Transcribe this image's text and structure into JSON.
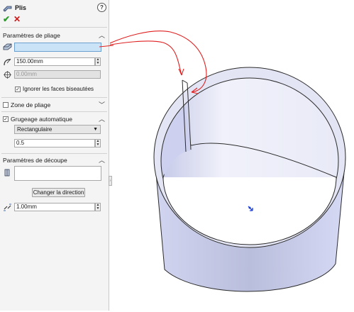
{
  "feature": {
    "title": "Plis"
  },
  "header": {
    "help_label": "?",
    "ok_symbol": "✔",
    "cancel_symbol": "✕"
  },
  "sections": {
    "bend_params": {
      "label": "Paramètres de pliage",
      "chevron": "︿"
    },
    "bend_zone": {
      "label": "Zone de pliage",
      "chevron": "﹀"
    },
    "auto_relief": {
      "label": "Grugeage automatique",
      "chevron": "︿",
      "checked": true
    },
    "rip_params": {
      "label": "Paramètres de découpe",
      "chevron": "︿"
    }
  },
  "bend": {
    "fixed_face_value": "",
    "radius_value": "150.00mm",
    "k_value": "0.00mm",
    "ignore_beveled_label": "Ignorer les faces biseautées",
    "ignore_beveled_checked": true
  },
  "relief": {
    "type_value": "Rectangulaire",
    "ratio_value": "0.5"
  },
  "rip": {
    "change_direction_label": "Changer la direction",
    "gap_value": "1.00mm"
  },
  "colors": {
    "selection_fill": "#cbe3f7",
    "arrow": "#e02020",
    "part_shade": "#d6d8f2",
    "part_edge": "#2b2b2b"
  }
}
